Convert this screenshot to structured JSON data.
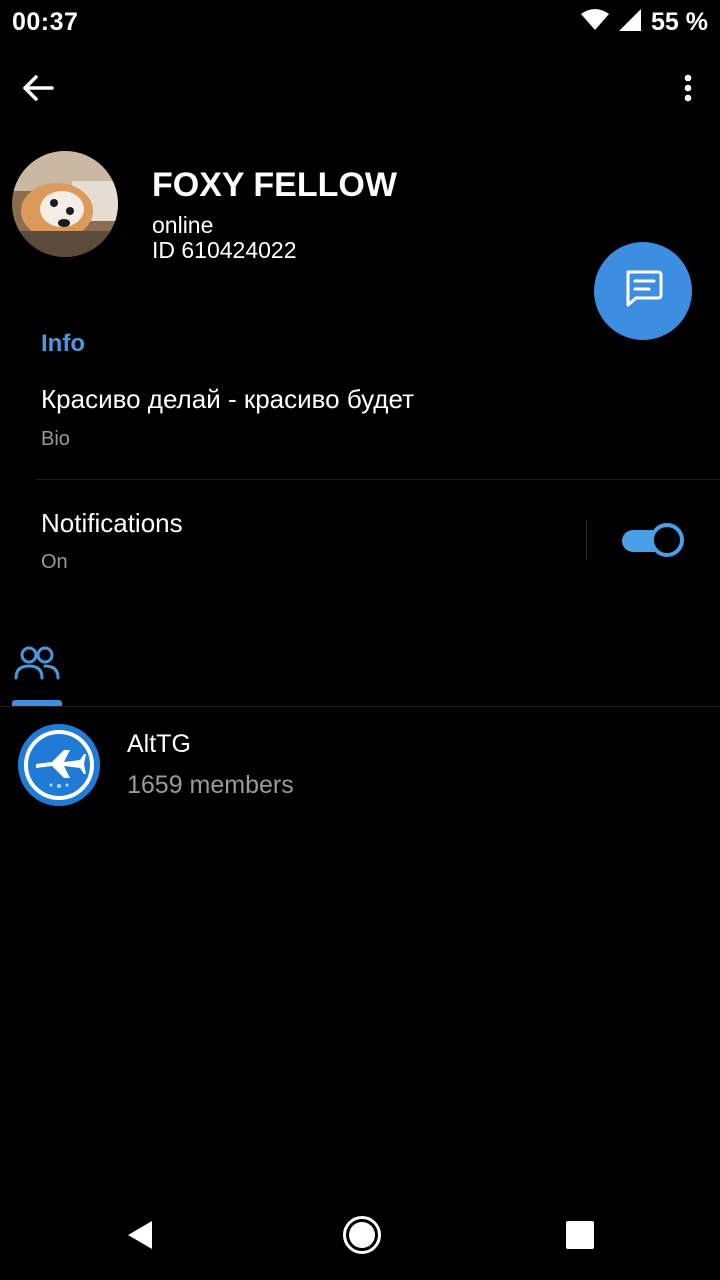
{
  "status_bar": {
    "time": "00:37",
    "battery": "55 %",
    "icons": [
      "wifi-icon",
      "signal-icon"
    ]
  },
  "app_bar": {
    "back_icon": "arrow-back-icon",
    "menu_icon": "more-vert-icon"
  },
  "profile": {
    "name": "FOXY FELLOW",
    "status": "online",
    "id": "ID 610424022",
    "fab_icon": "message-icon"
  },
  "info": {
    "section_title": "Info",
    "bio": "Красиво делай - красиво будет",
    "bio_label": "Bio"
  },
  "notifications": {
    "title": "Notifications",
    "value": "On",
    "enabled": true
  },
  "tabs": [
    {
      "icon": "groups-icon",
      "active": true
    }
  ],
  "groups": [
    {
      "name": "AltTG",
      "members": "1659 members"
    }
  ],
  "colors": {
    "accent": "#3d8ee0",
    "section_title": "#4a98e0",
    "toggle": "#4aa0e6",
    "secondary_text": "#9a9a9a",
    "background": "#000000"
  },
  "nav_bar": {
    "icons": [
      "nav-back-icon",
      "nav-home-icon",
      "nav-recents-icon"
    ]
  }
}
